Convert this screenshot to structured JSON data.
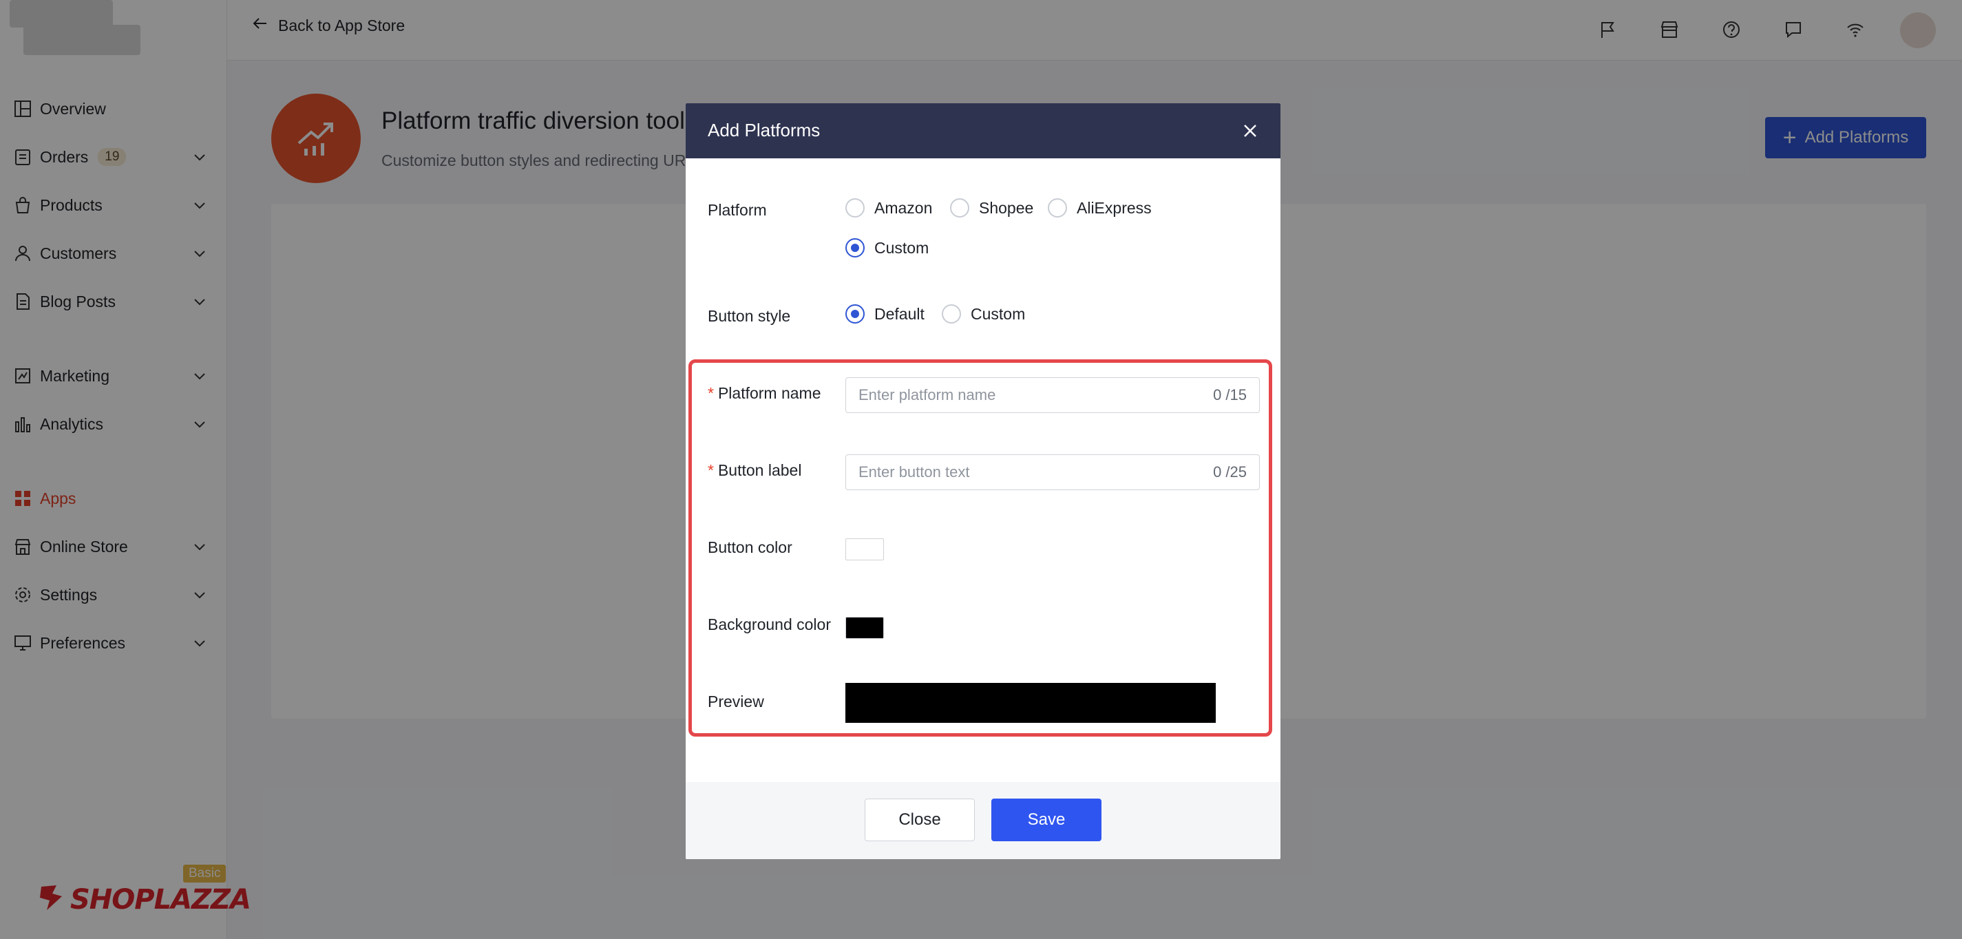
{
  "sidebar": {
    "items": [
      {
        "label": "Overview",
        "icon": "layout-icon",
        "chevron": false
      },
      {
        "label": "Orders",
        "icon": "clipboard-icon",
        "chevron": true,
        "badge": "19"
      },
      {
        "label": "Products",
        "icon": "bag-icon",
        "chevron": true
      },
      {
        "label": "Customers",
        "icon": "user-icon",
        "chevron": true
      },
      {
        "label": "Blog Posts",
        "icon": "document-icon",
        "chevron": true
      },
      {
        "label": "Marketing",
        "icon": "marketing-icon",
        "chevron": true
      },
      {
        "label": "Analytics",
        "icon": "bar-chart-icon",
        "chevron": true
      },
      {
        "label": "Apps",
        "icon": "apps-icon",
        "chevron": false,
        "active": true
      },
      {
        "label": "Online Store",
        "icon": "store-icon",
        "chevron": true
      },
      {
        "label": "Settings",
        "icon": "gear-icon",
        "chevron": true
      },
      {
        "label": "Preferences",
        "icon": "monitor-icon",
        "chevron": true
      }
    ],
    "brand": "SHOPLAZZA",
    "plan_tag": "Basic"
  },
  "topbar": {
    "back_label": "Back to App Store",
    "icons": [
      "flag-icon",
      "store-icon",
      "help-icon",
      "chat-icon",
      "wifi-icon"
    ]
  },
  "page": {
    "title": "Platform traffic diversion tools",
    "subtitle": "Customize button styles and redirecting URLs",
    "add_button": "Add Platforms"
  },
  "modal": {
    "title": "Add Platforms",
    "platform": {
      "label": "Platform",
      "options": [
        "Amazon",
        "Shopee",
        "AliExpress",
        "Custom"
      ],
      "selected": "Custom"
    },
    "button_style": {
      "label": "Button style",
      "options": [
        "Default",
        "Custom"
      ],
      "selected": "Default"
    },
    "platform_name": {
      "label": "Platform name",
      "placeholder": "Enter platform name",
      "counter": "0 /15"
    },
    "button_label": {
      "label": "Button label",
      "placeholder": "Enter button text",
      "counter": "0 /25"
    },
    "button_color": {
      "label": "Button color",
      "value": "#ffffff"
    },
    "background_color": {
      "label": "Background color",
      "value": "#000000"
    },
    "preview": {
      "label": "Preview"
    },
    "close_button": "Close",
    "save_button": "Save"
  },
  "colors": {
    "accent": "#2f55d4",
    "highlight": "#e5474a",
    "modal_header": "#2e3350",
    "app_icon": "#e5522d"
  }
}
